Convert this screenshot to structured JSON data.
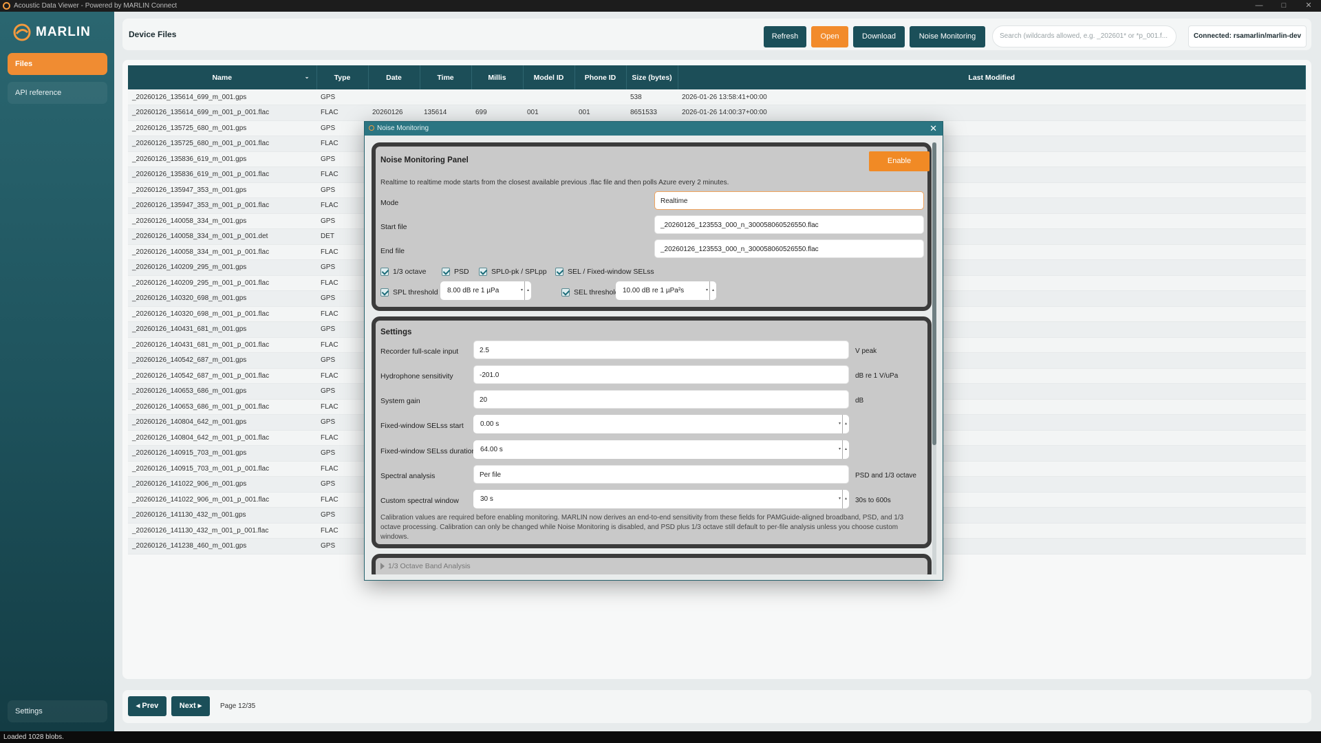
{
  "window": {
    "title": "Acoustic Data Viewer - Powered by MARLIN Connect",
    "controls": [
      "—",
      "□",
      "✕"
    ]
  },
  "sidebar": {
    "brand": "MARLIN",
    "items": [
      {
        "label": "Files"
      },
      {
        "label": "API reference"
      }
    ],
    "settings_label": "Settings"
  },
  "header": {
    "title": "Device Files",
    "buttons": {
      "refresh": "Refresh",
      "open": "Open",
      "download": "Download",
      "noise": "Noise Monitoring"
    },
    "search_placeholder": "Search (wildcards allowed, e.g. _202601* or *p_001.f...",
    "connected": "Connected: rsamarlin/marlin-dev"
  },
  "table": {
    "columns": [
      "Name",
      "Type",
      "Date",
      "Time",
      "Millis",
      "Model ID",
      "Phone ID",
      "Size (bytes)",
      "Last Modified"
    ],
    "rows": [
      [
        "_20260126_135614_699_m_001.gps",
        "GPS",
        "",
        "",
        "",
        "",
        "",
        "538",
        "2026-01-26 13:58:41+00:00"
      ],
      [
        "_20260126_135614_699_m_001_p_001.flac",
        "FLAC",
        "20260126",
        "135614",
        "699",
        "001",
        "001",
        "8651533",
        "2026-01-26 14:00:37+00:00"
      ],
      [
        "_20260126_135725_680_m_001.gps",
        "GPS",
        "",
        "",
        "",
        "",
        "",
        "",
        ""
      ],
      [
        "_20260126_135725_680_m_001_p_001.flac",
        "FLAC",
        "",
        "",
        "",
        "",
        "",
        "",
        ""
      ],
      [
        "_20260126_135836_619_m_001.gps",
        "GPS",
        "",
        "",
        "",
        "",
        "",
        "",
        ""
      ],
      [
        "_20260126_135836_619_m_001_p_001.flac",
        "FLAC",
        "",
        "",
        "",
        "",
        "",
        "",
        ""
      ],
      [
        "_20260126_135947_353_m_001.gps",
        "GPS",
        "",
        "",
        "",
        "",
        "",
        "",
        ""
      ],
      [
        "_20260126_135947_353_m_001_p_001.flac",
        "FLAC",
        "",
        "",
        "",
        "",
        "",
        "",
        ""
      ],
      [
        "_20260126_140058_334_m_001.gps",
        "GPS",
        "",
        "",
        "",
        "",
        "",
        "",
        ""
      ],
      [
        "_20260126_140058_334_m_001_p_001.det",
        "DET",
        "",
        "",
        "",
        "",
        "",
        "",
        ""
      ],
      [
        "_20260126_140058_334_m_001_p_001.flac",
        "FLAC",
        "",
        "",
        "",
        "",
        "",
        "",
        ""
      ],
      [
        "_20260126_140209_295_m_001.gps",
        "GPS",
        "",
        "",
        "",
        "",
        "",
        "",
        ""
      ],
      [
        "_20260126_140209_295_m_001_p_001.flac",
        "FLAC",
        "",
        "",
        "",
        "",
        "",
        "",
        ""
      ],
      [
        "_20260126_140320_698_m_001.gps",
        "GPS",
        "",
        "",
        "",
        "",
        "",
        "",
        ""
      ],
      [
        "_20260126_140320_698_m_001_p_001.flac",
        "FLAC",
        "",
        "",
        "",
        "",
        "",
        "",
        ""
      ],
      [
        "_20260126_140431_681_m_001.gps",
        "GPS",
        "",
        "",
        "",
        "",
        "",
        "",
        ""
      ],
      [
        "_20260126_140431_681_m_001_p_001.flac",
        "FLAC",
        "",
        "",
        "",
        "",
        "",
        "",
        ""
      ],
      [
        "_20260126_140542_687_m_001.gps",
        "GPS",
        "",
        "",
        "",
        "",
        "",
        "",
        ""
      ],
      [
        "_20260126_140542_687_m_001_p_001.flac",
        "FLAC",
        "",
        "",
        "",
        "",
        "",
        "",
        ""
      ],
      [
        "_20260126_140653_686_m_001.gps",
        "GPS",
        "",
        "",
        "",
        "",
        "",
        "",
        ""
      ],
      [
        "_20260126_140653_686_m_001_p_001.flac",
        "FLAC",
        "",
        "",
        "",
        "",
        "",
        "",
        ""
      ],
      [
        "_20260126_140804_642_m_001.gps",
        "GPS",
        "",
        "",
        "",
        "",
        "",
        "",
        ""
      ],
      [
        "_20260126_140804_642_m_001_p_001.flac",
        "FLAC",
        "",
        "",
        "",
        "",
        "",
        "",
        ""
      ],
      [
        "_20260126_140915_703_m_001.gps",
        "GPS",
        "",
        "",
        "",
        "",
        "",
        "",
        ""
      ],
      [
        "_20260126_140915_703_m_001_p_001.flac",
        "FLAC",
        "",
        "",
        "",
        "",
        "",
        "",
        ""
      ],
      [
        "_20260126_141022_906_m_001.gps",
        "GPS",
        "",
        "",
        "",
        "",
        "",
        "",
        ""
      ],
      [
        "_20260126_141022_906_m_001_p_001.flac",
        "FLAC",
        "",
        "",
        "",
        "",
        "",
        "",
        ""
      ],
      [
        "_20260126_141130_432_m_001.gps",
        "GPS",
        "",
        "",
        "",
        "",
        "",
        "",
        ""
      ],
      [
        "_20260126_141130_432_m_001_p_001.flac",
        "FLAC",
        "",
        "",
        "",
        "",
        "",
        "",
        ""
      ],
      [
        "_20260126_141238_460_m_001.gps",
        "GPS",
        "",
        "",
        "",
        "",
        "",
        "",
        ""
      ]
    ]
  },
  "pager": {
    "prev": "◂ Prev",
    "next": "Next ▸",
    "page_label": "Page 12/35"
  },
  "status": "Loaded 1028 blobs.",
  "modal": {
    "title": "Noise Monitoring",
    "panel": {
      "title": "Noise Monitoring Panel",
      "enable": "Enable",
      "description": "Realtime to realtime mode starts from the closest available previous .flac file and then polls Azure every 2 minutes.",
      "mode_label": "Mode",
      "mode_value": "Realtime",
      "start_label": "Start file",
      "start_value": "_20260126_123553_000_n_300058060526550.flac",
      "end_label": "End file",
      "end_value": "_20260126_123553_000_n_300058060526550.flac",
      "checks": [
        "1/3 octave",
        "PSD",
        "SPL0-pk / SPLpp",
        "SEL / Fixed-window SELss"
      ],
      "spl_threshold_label": "SPL threshold",
      "spl_threshold_value": "8.00 dB re 1 µPa",
      "sel_threshold_label": "SEL threshold",
      "sel_threshold_value": "10.00 dB re 1 µPa²s"
    },
    "settings": {
      "title": "Settings",
      "fields": [
        {
          "label": "Recorder full-scale input",
          "value": "2.5",
          "unit": "V peak"
        },
        {
          "label": "Hydrophone sensitivity",
          "value": "-201.0",
          "unit": "dB re 1 V/uPa"
        },
        {
          "label": "System gain",
          "value": "20",
          "unit": "dB"
        },
        {
          "label": "Fixed-window SELss start",
          "value": "0.00 s",
          "unit": ""
        },
        {
          "label": "Fixed-window SELss duration",
          "value": "64.00 s",
          "unit": ""
        },
        {
          "label": "Spectral analysis",
          "value": "Per file",
          "unit": "PSD and 1/3 octave"
        },
        {
          "label": "Custom spectral window",
          "value": "30 s",
          "unit": "30s to 600s"
        }
      ],
      "calibration_note": "Calibration values are required before enabling monitoring. MARLIN now derives an end-to-end sensitivity from these fields for PAMGuide-aligned broadband, PSD, and 1/3 octave processing. Calibration can only be changed while Noise Monitoring is disabled, and PSD plus 1/3 octave still default to per-file analysis unless you choose custom windows."
    },
    "accordion_label": "1/3 Octave Band Analysis"
  },
  "colors": {
    "accent": "#f28b2b",
    "primary": "#1b4f59",
    "sidebar": "#1f545e"
  }
}
